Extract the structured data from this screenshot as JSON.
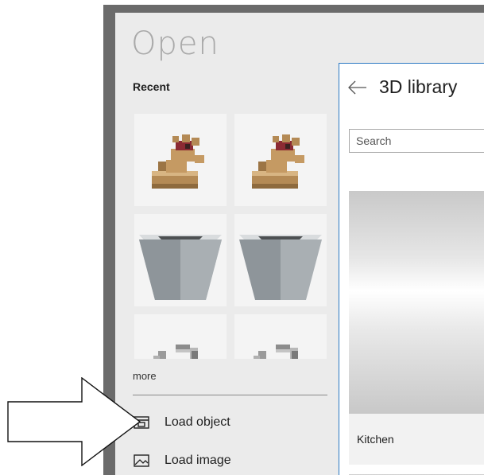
{
  "dialog": {
    "title": "Open",
    "recent_label": "Recent",
    "more_label": "more",
    "recent_items": [
      {
        "name": "recent-model-1",
        "icon": "voxel-figure"
      },
      {
        "name": "recent-model-2",
        "icon": "voxel-figure"
      },
      {
        "name": "recent-model-3",
        "icon": "grey-planter-box"
      },
      {
        "name": "recent-model-4",
        "icon": "grey-planter-box"
      },
      {
        "name": "recent-model-5",
        "icon": "grey-blocks"
      },
      {
        "name": "recent-model-6",
        "icon": "grey-blocks"
      }
    ],
    "menu": [
      {
        "label": "Load object",
        "icon": "load-object-icon"
      },
      {
        "label": "Load image",
        "icon": "load-image-icon"
      }
    ]
  },
  "library": {
    "title": "3D library",
    "search_placeholder": "Search",
    "cards": [
      {
        "title": "Kitchen"
      }
    ]
  },
  "colors": {
    "accent": "#2b79c2",
    "panel_bg": "#ebebeb",
    "frame": "#6b6b6b"
  }
}
